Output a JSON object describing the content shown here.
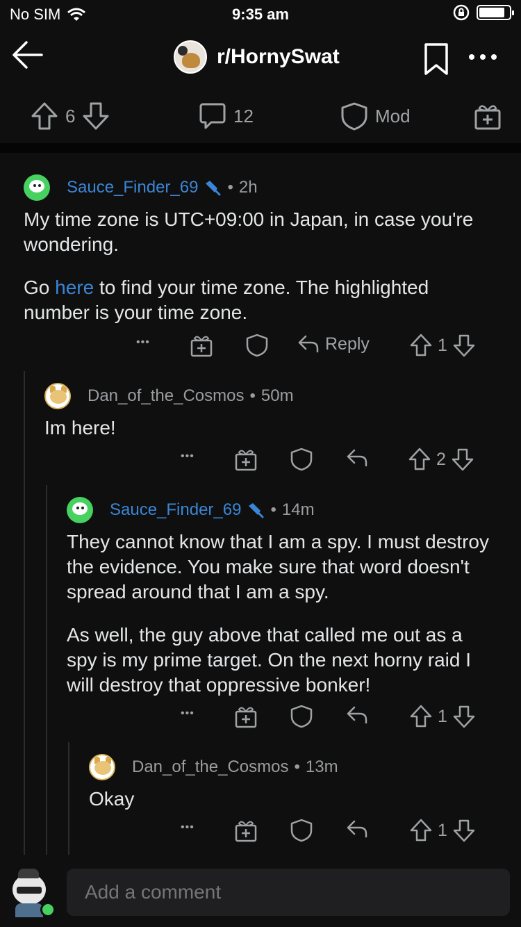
{
  "status_bar": {
    "carrier": "No SIM",
    "time": "9:35 am"
  },
  "header": {
    "subreddit": "r/HornySwat"
  },
  "post_actions": {
    "upvotes": "6",
    "comments": "12",
    "mod_label": "Mod"
  },
  "comments": [
    {
      "username": "Sauce_Finder_69",
      "sep": "•",
      "time": "2h",
      "paragraphs": [
        "My time zone is UTC+09:00 in Japan, in case you're wondering."
      ],
      "p2_pre": "Go ",
      "p2_link": "here",
      "p2_post": " to find your time zone. The highlighted number is your time zone.",
      "more": "•••",
      "reply_label": "Reply",
      "votes": "1"
    },
    {
      "username": "Dan_of_the_Cosmos",
      "sep": "•",
      "time": "50m",
      "paragraphs": [
        "Im here!"
      ],
      "more": "•••",
      "votes": "2"
    },
    {
      "username": "Sauce_Finder_69",
      "sep": "•",
      "time": "14m",
      "paragraphs": [
        "They cannot know that I am a spy. I must destroy the evidence. You make sure that word doesn't spread around that I am a spy.",
        "As well, the guy above that called me out as a spy is my prime target. On the next horny raid I will destroy that oppressive bonker!"
      ],
      "more": "•••",
      "votes": "1"
    },
    {
      "username": "Dan_of_the_Cosmos",
      "sep": "•",
      "time": "13m",
      "paragraphs": [
        "Okay"
      ],
      "more": "•••",
      "votes": "1"
    }
  ],
  "comment_input": {
    "placeholder": "Add a comment"
  },
  "colors": {
    "background": "#0f0f0f",
    "op_username": "#3a86d6",
    "online": "#46d160"
  }
}
